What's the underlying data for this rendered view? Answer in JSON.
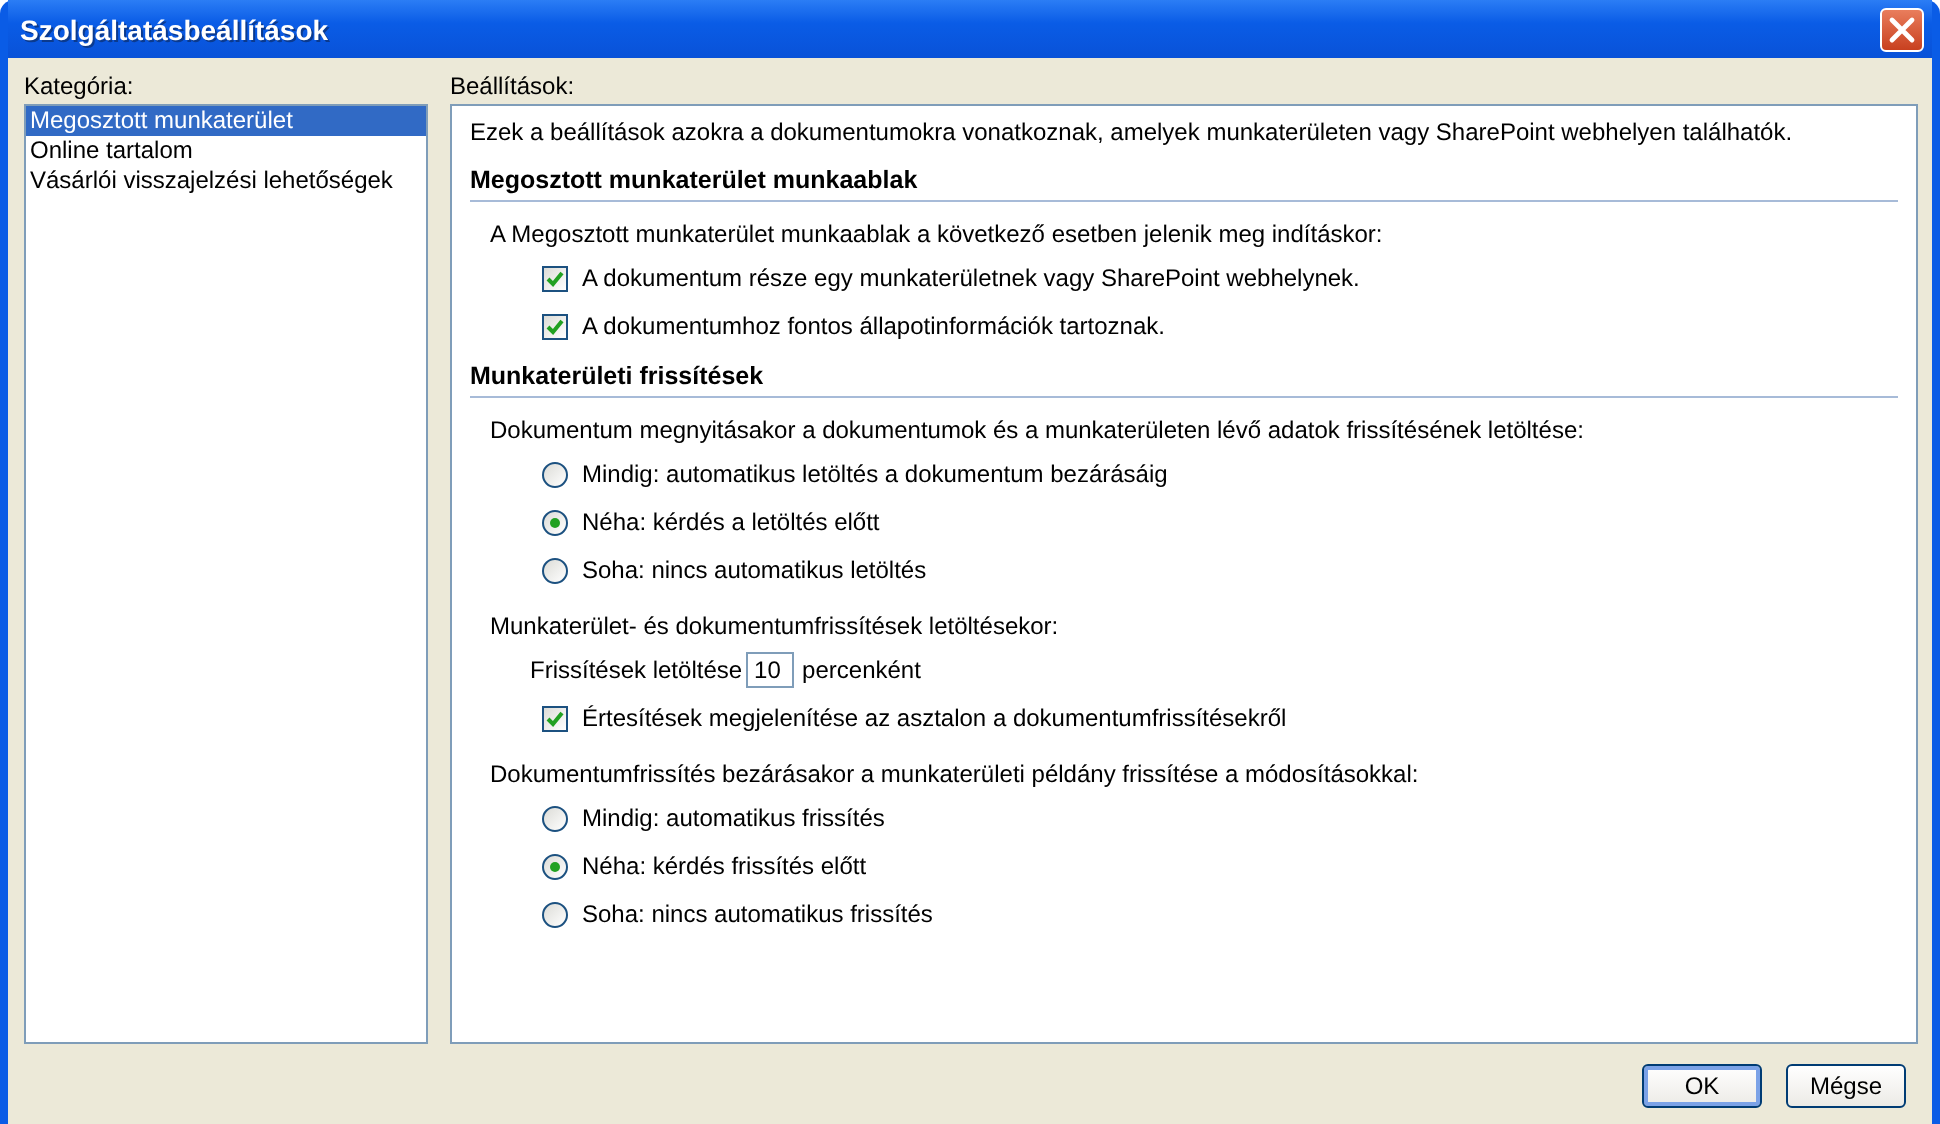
{
  "window": {
    "title": "Szolgáltatásbeállítások"
  },
  "category": {
    "label": "Kategória:",
    "items": [
      {
        "label": "Megosztott munkaterület",
        "selected": true
      },
      {
        "label": "Online tartalom",
        "selected": false
      },
      {
        "label": "Vásárlói visszajelzési lehetőségek",
        "selected": false
      }
    ]
  },
  "settings": {
    "label": "Beállítások:",
    "description": "Ezek a beállítások azokra a dokumentumokra vonatkoznak, amelyek munkaterületen vagy SharePoint webhelyen találhatók.",
    "sections": [
      {
        "heading": "Megosztott munkaterület munkaablak",
        "groups": [
          {
            "label": "A Megosztott munkaterület munkaablak a következő esetben jelenik meg indításkor:",
            "items": [
              {
                "kind": "checkbox",
                "label": "A dokumentum része egy munkaterületnek vagy SharePoint webhelynek.",
                "checked": true
              },
              {
                "kind": "checkbox",
                "label": "A dokumentumhoz fontos állapotinformációk tartoznak.",
                "checked": true
              }
            ]
          }
        ]
      },
      {
        "heading": "Munkaterületi frissítések",
        "groups": [
          {
            "label": "Dokumentum megnyitásakor a dokumentumok és a munkaterületen lévő adatok frissítésének letöltése:",
            "items": [
              {
                "kind": "radio",
                "label": "Mindig: automatikus letöltés a dokumentum bezárásáig",
                "selected": false
              },
              {
                "kind": "radio",
                "label": "Néha: kérdés a letöltés előtt",
                "selected": true
              },
              {
                "kind": "radio",
                "label": "Soha: nincs automatikus letöltés",
                "selected": false
              }
            ]
          },
          {
            "label": "Munkaterület- és dokumentumfrissítések letöltésekor:",
            "items": [
              {
                "kind": "number",
                "prefix": "Frissítések letöltése",
                "value": "10",
                "suffix": "percenként"
              },
              {
                "kind": "checkbox",
                "label": "Értesítések megjelenítése az asztalon a dokumentumfrissítésekről",
                "checked": true
              }
            ]
          },
          {
            "label": "Dokumentumfrissítés bezárásakor a munkaterületi példány frissítése a módosításokkal:",
            "items": [
              {
                "kind": "radio",
                "label": "Mindig: automatikus frissítés",
                "selected": false
              },
              {
                "kind": "radio",
                "label": "Néha: kérdés frissítés előtt",
                "selected": true
              },
              {
                "kind": "radio",
                "label": "Soha: nincs automatikus frissítés",
                "selected": false
              }
            ]
          }
        ]
      }
    ]
  },
  "buttons": [
    {
      "label": "OK",
      "default": true
    },
    {
      "label": "Mégse",
      "default": false
    }
  ]
}
